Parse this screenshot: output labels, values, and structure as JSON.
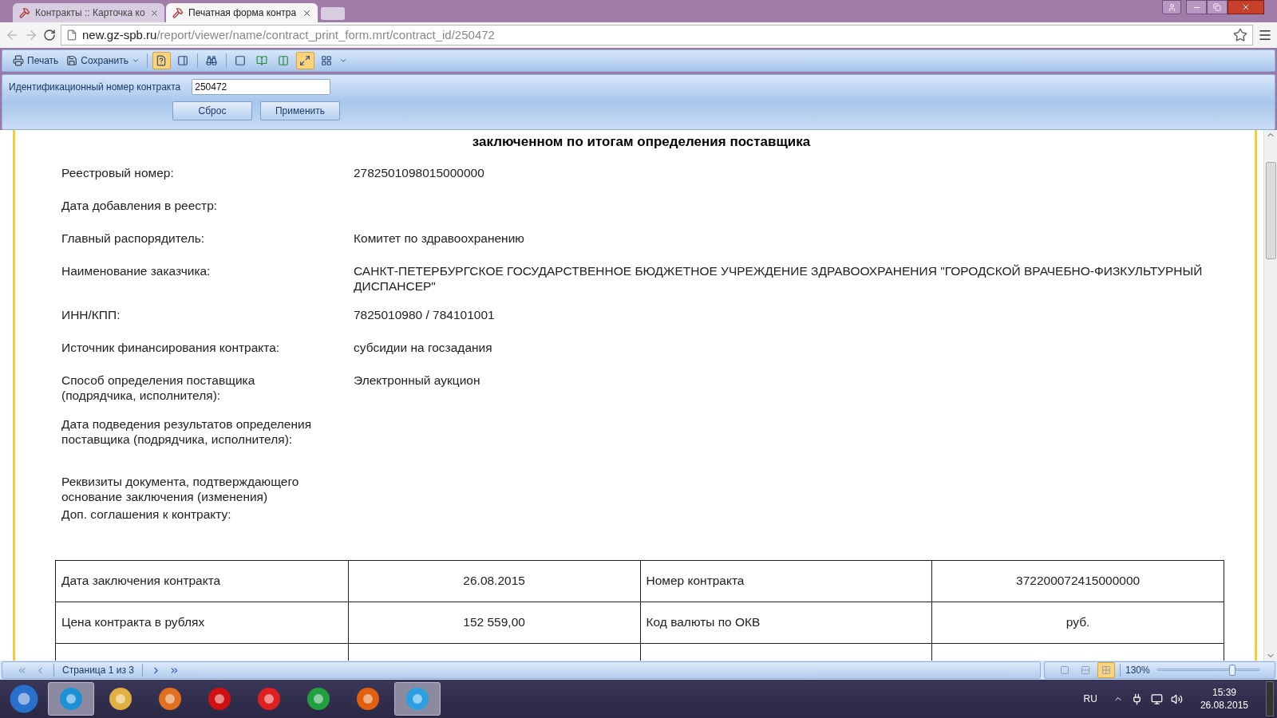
{
  "browser": {
    "tabs": [
      {
        "label": "Контракты :: Карточка ко",
        "selected": false
      },
      {
        "label": "Печатная форма контра",
        "selected": true
      }
    ],
    "address": {
      "host": "new.gz-spb.ru",
      "path": "/report/viewer/name/contract_print_form.mrt/contract_id/250472"
    }
  },
  "toolbar": {
    "buttons": [
      {
        "label": "Печать",
        "kind": "print"
      },
      {
        "label": "Сохранить",
        "kind": "save"
      }
    ],
    "toggles": [
      {
        "selected": true
      },
      {
        "selected": false
      },
      {
        "selected": false
      },
      {
        "selected": false
      },
      {
        "selected": false
      },
      {
        "selected": false
      },
      {
        "selected": true
      },
      {
        "selected": false
      }
    ]
  },
  "parameters": {
    "label": "Идентификационный номер контракта",
    "value": "250472",
    "buttons": [
      "Сброс",
      "Применить"
    ]
  },
  "report": {
    "heading": "заключенном по итогам определения поставщика",
    "fields": [
      {
        "label": "Реестровый номер:",
        "value": "2782501098015000000"
      },
      {
        "label": "Дата добавления в реестр:"
      },
      {
        "label": "Главный распорядитель:",
        "value": "Комитет по здравоохранению"
      },
      {
        "label": "Наименование заказчика:",
        "value": "САНКТ-ПЕТЕРБУРГСКОЕ ГОСУДАРСТВЕННОЕ БЮДЖЕТНОЕ УЧРЕЖДЕНИЕ ЗДРАВООХРАНЕНИЯ \"ГОРОДСКОЙ ВРАЧЕБНО-ФИЗКУЛЬТУРНЫЙ ДИСПАНСЕР\""
      },
      {
        "label": "ИНН/КПП:",
        "value": "7825010980 / 784101001"
      },
      {
        "label": "Источник финансирования контракта:",
        "value": "субсидии на госзадания"
      },
      {
        "label": "Способ определения поставщика (подрядчика, исполнителя):",
        "value": "Электронный аукцион"
      },
      {
        "label": "Дата подведения результатов определения поставщика (подрядчика, исполнителя):"
      },
      {
        "label": "Реквизиты документа, подтверждающего основание заключения (изменения)"
      },
      {
        "label": "Доп. соглашения к контракту:"
      }
    ],
    "table": [
      [
        "Дата заключения контракта",
        "26.08.2015",
        "Номер контракта",
        "372200072415000000"
      ],
      [
        "Цена контракта в рублях",
        "152 559,00",
        "Код валюты по ОКВ",
        "руб."
      ]
    ]
  },
  "status_bar": {
    "page": "Страница 1 из 3",
    "views": [
      {
        "selected": false
      },
      {
        "selected": false
      },
      {
        "selected": true
      }
    ],
    "zoom": "130%",
    "zoom_level": {
      "level": 0.73
    }
  },
  "taskbar": {
    "apps": [
      {
        "selected": true
      },
      {
        "selected": false
      },
      {
        "selected": false
      },
      {
        "selected": false
      },
      {
        "selected": false
      },
      {
        "selected": false
      },
      {
        "selected": false
      },
      {
        "selected": true
      }
    ],
    "language": "RU",
    "time": "15:39",
    "date": "26.08.2015"
  }
}
